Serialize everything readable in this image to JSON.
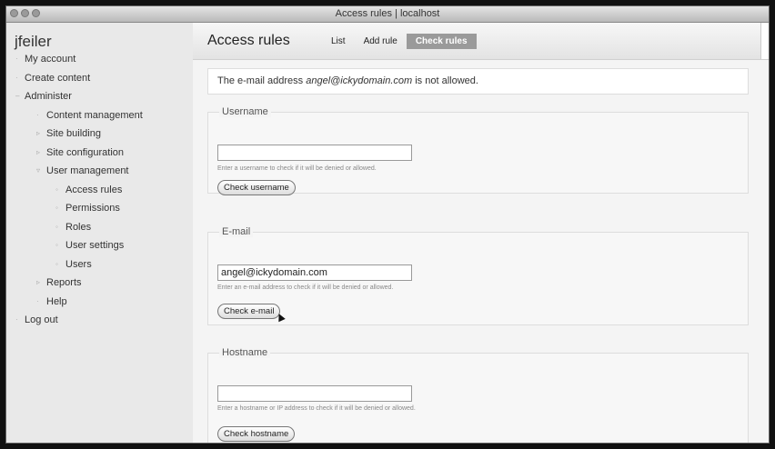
{
  "window": {
    "title": "Access rules | localhost"
  },
  "sidebar": {
    "site_name": "jfeiler",
    "items": [
      {
        "label": "My account",
        "bullet": "·"
      },
      {
        "label": "Create content",
        "bullet": "·"
      },
      {
        "label": "Administer",
        "bullet": "–"
      },
      {
        "label": "Content management",
        "bullet": "·"
      },
      {
        "label": "Site building",
        "bullet": "▹"
      },
      {
        "label": "Site configuration",
        "bullet": "▹"
      },
      {
        "label": "User management",
        "bullet": "▿"
      },
      {
        "label": "Access rules",
        "bullet": "◦"
      },
      {
        "label": "Permissions",
        "bullet": "◦"
      },
      {
        "label": "Roles",
        "bullet": "◦"
      },
      {
        "label": "User settings",
        "bullet": "◦"
      },
      {
        "label": "Users",
        "bullet": "◦"
      },
      {
        "label": "Reports",
        "bullet": "▹"
      },
      {
        "label": "Help",
        "bullet": "·"
      },
      {
        "label": "Log out",
        "bullet": "·"
      }
    ]
  },
  "header": {
    "title": "Access rules",
    "tabs": [
      "List",
      "Add rule",
      "Check rules"
    ],
    "active_tab": "Check rules"
  },
  "message": {
    "prefix": "The e-mail address ",
    "email": "angel@ickydomain.com",
    "suffix": " is not allowed."
  },
  "username": {
    "legend": "Username",
    "value": "",
    "description": "Enter a username to check if it will be denied or allowed.",
    "button": "Check username"
  },
  "email": {
    "legend": "E-mail",
    "value": "angel@ickydomain.com",
    "description": "Enter an e-mail address to check if it will be denied or allowed.",
    "button": "Check e-mail"
  },
  "hostname": {
    "legend": "Hostname",
    "value": "",
    "description": "Enter a hostname or IP address to check if it will be denied or allowed.",
    "button": "Check hostname"
  }
}
